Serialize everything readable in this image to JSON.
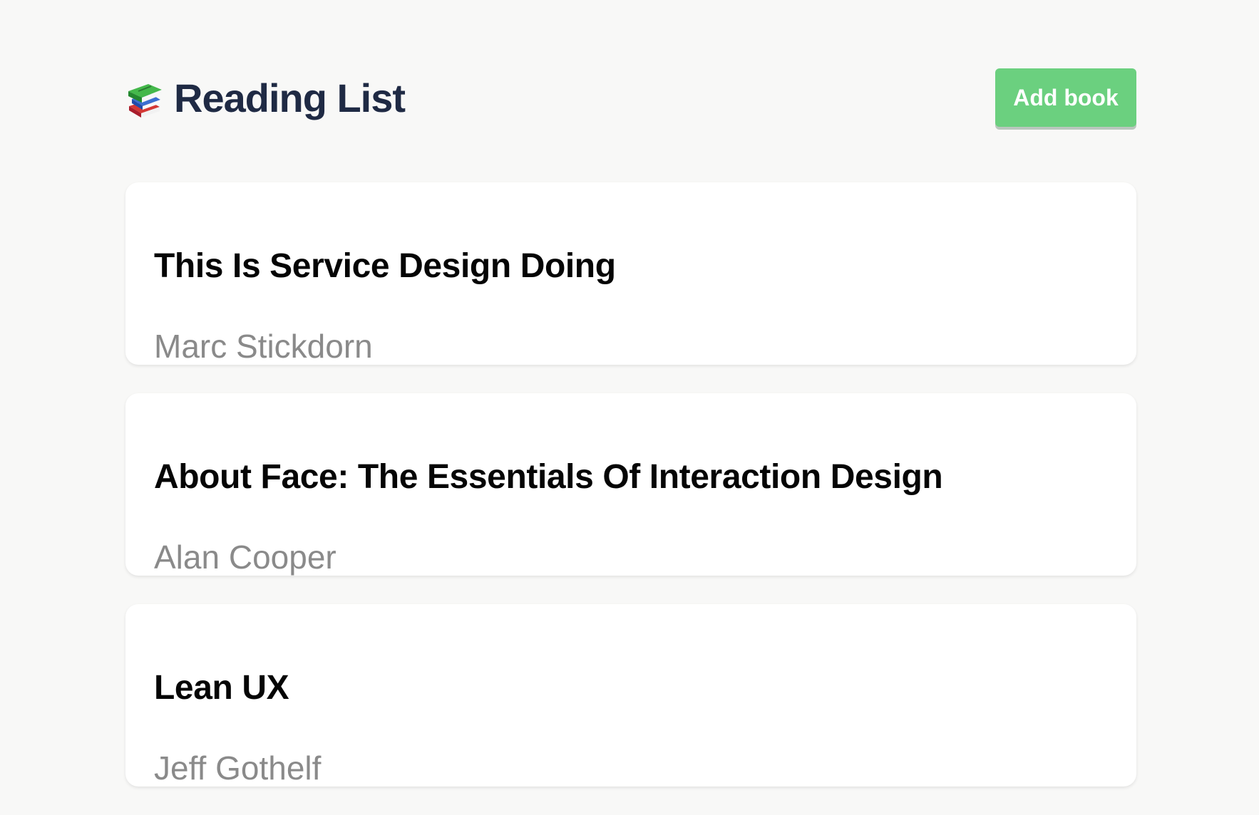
{
  "header": {
    "title": "Reading List",
    "icon": "books-icon",
    "add_button_label": "Add book"
  },
  "colors": {
    "background": "#f8f8f7",
    "title": "#1f2a44",
    "accent": "#6bd07f",
    "card": "#ffffff",
    "author_text": "#8a8a8a"
  },
  "books": [
    {
      "title": "This Is Service Design Doing",
      "author": "Marc Stickdorn"
    },
    {
      "title": "About Face: The Essentials Of Interaction Design",
      "author": "Alan Cooper"
    },
    {
      "title": "Lean UX",
      "author": "Jeff Gothelf"
    }
  ]
}
